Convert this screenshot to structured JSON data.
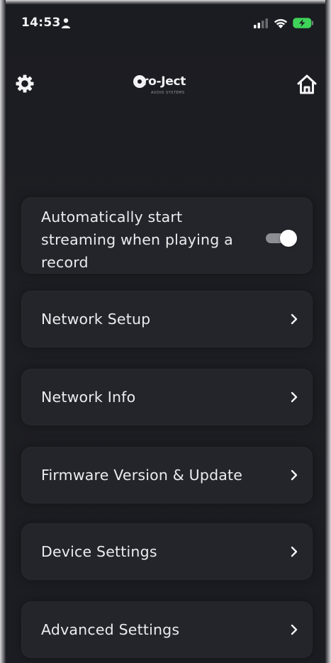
{
  "status_bar": {
    "time": "14:53",
    "person_icon": "person-icon",
    "signal_icon": "cellular-signal-icon",
    "wifi_icon": "wifi-icon",
    "battery_icon": "battery-charging-icon",
    "battery_color": "#3fd35a"
  },
  "header": {
    "logo_text": "ro-Ject",
    "logo_tagline": "AUDIO SYSTEMS",
    "settings_icon": "gear-icon",
    "home_icon": "home-icon"
  },
  "settings": {
    "auto_stream": {
      "label": "Automatically start streaming when playing a record",
      "enabled": true
    },
    "items": [
      {
        "label": "Network Setup"
      },
      {
        "label": "Network Info"
      },
      {
        "label": "Firmware Version & Update"
      },
      {
        "label": "Device Settings"
      },
      {
        "label": "Advanced Settings"
      }
    ]
  },
  "colors": {
    "background": "#1b1c21",
    "card": "#24252b",
    "text": "#ececef",
    "toggle_track": "#8d8e93"
  }
}
